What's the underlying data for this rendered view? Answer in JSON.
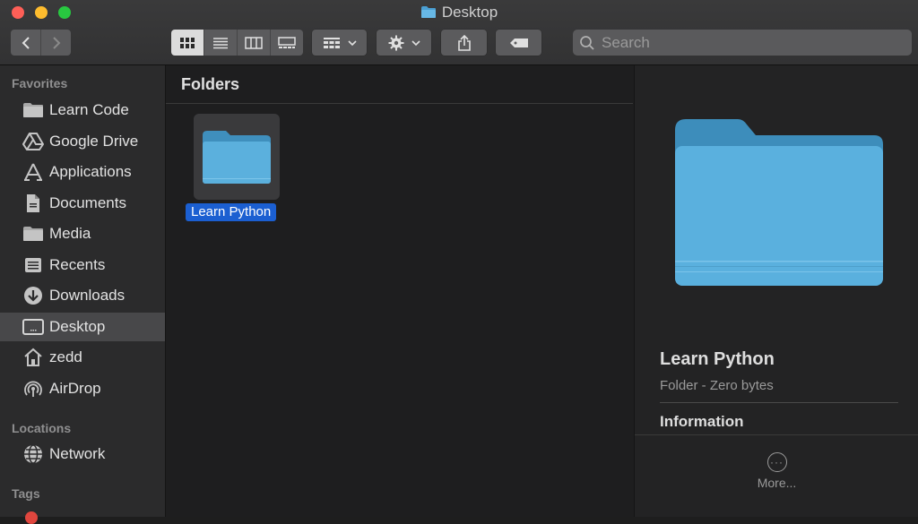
{
  "window": {
    "title": "Desktop"
  },
  "toolbar": {
    "search_placeholder": "Search"
  },
  "sidebar": {
    "favorites_label": "Favorites",
    "favorites": [
      {
        "label": "Learn Code",
        "icon": "folder-icon"
      },
      {
        "label": "Google Drive",
        "icon": "google-drive-icon"
      },
      {
        "label": "Applications",
        "icon": "applications-icon"
      },
      {
        "label": "Documents",
        "icon": "document-icon"
      },
      {
        "label": "Media",
        "icon": "folder-icon"
      },
      {
        "label": "Recents",
        "icon": "recents-icon"
      },
      {
        "label": "Downloads",
        "icon": "download-icon"
      },
      {
        "label": "Desktop",
        "icon": "desktop-icon",
        "selected": true
      },
      {
        "label": "zedd",
        "icon": "home-icon"
      },
      {
        "label": "AirDrop",
        "icon": "airdrop-icon"
      }
    ],
    "locations_label": "Locations",
    "locations": [
      {
        "label": "Network",
        "icon": "network-icon"
      }
    ],
    "tags_label": "Tags"
  },
  "main": {
    "section_title": "Folders",
    "items": [
      {
        "label": "Learn Python",
        "icon": "folder-icon",
        "selected": true
      }
    ]
  },
  "preview": {
    "name": "Learn Python",
    "subtitle": "Folder - Zero bytes",
    "info_title": "Information",
    "more_label": "More..."
  },
  "colors": {
    "selection": "#1b5fd1",
    "folder_blue": "#5bb0dd",
    "close": "#fe5f57",
    "minimize": "#febc2e",
    "maximize": "#28c840"
  }
}
